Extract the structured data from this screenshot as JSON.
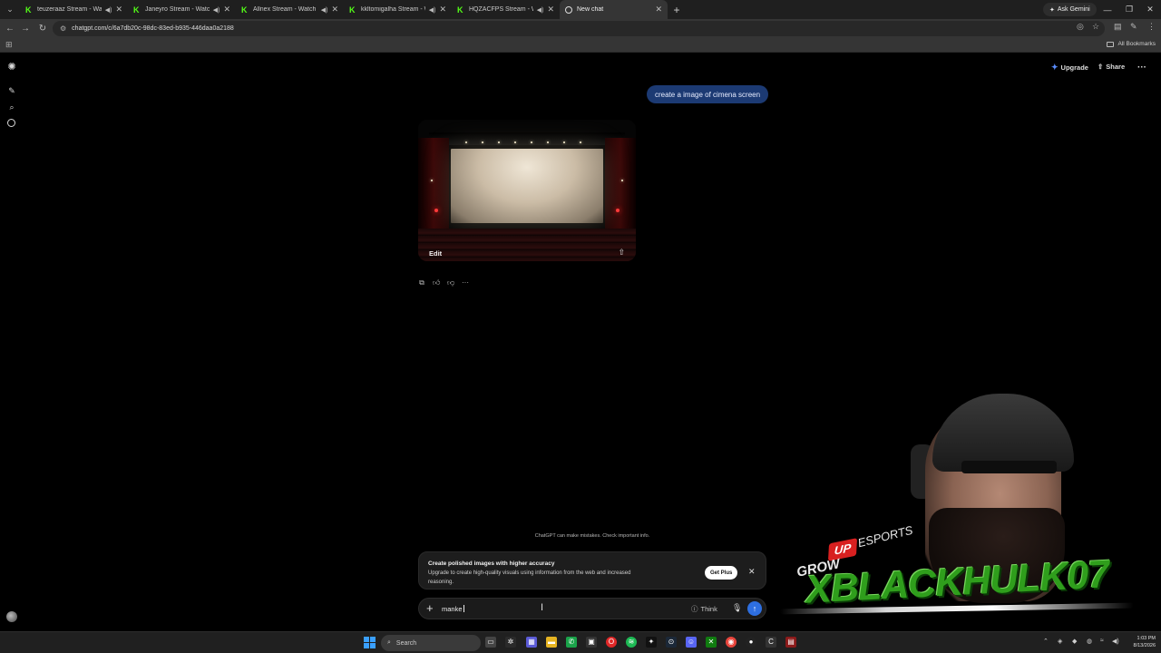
{
  "browser": {
    "tabs": [
      {
        "title": "teuzeraaz Stream - Watch L",
        "favicon": "kick-icon",
        "audio": true
      },
      {
        "title": "Janeyro Stream - Watch Live",
        "favicon": "kick-icon",
        "audio": true
      },
      {
        "title": "Allnex Stream - Watch Live",
        "favicon": "kick-icon",
        "audio": true
      },
      {
        "title": "kkltomigalha Stream - Watch",
        "favicon": "kick-icon",
        "audio": true
      },
      {
        "title": "HQZACFPS Stream - Watch Li",
        "favicon": "kick-icon",
        "audio": true
      },
      {
        "title": "New chat",
        "favicon": "chatgpt-icon",
        "audio": false
      }
    ],
    "ask_gemini_label": "Ask Gemini",
    "url": "chatgpt.com/c/6a7db20c-98dc-83ed-b935-446daa0a2188",
    "all_bookmarks_label": "All Bookmarks"
  },
  "chat": {
    "upgrade_label": "Upgrade",
    "share_label": "Share",
    "user_message": "create a image of cimena screen",
    "image_edit_label": "Edit",
    "disclaimer": "ChatGPT can make mistakes. Check important info.",
    "promo": {
      "title": "Create polished images with higher accuracy",
      "body": "Upgrade to create high-quality visuals using information from the web and increased reasoning.",
      "button": "Get Plus"
    },
    "composer": {
      "text": "manke",
      "think_label": "Think"
    }
  },
  "overlay": {
    "grow": "GROW",
    "up": "UP",
    "esports": "ESPORTS",
    "name": "XBLACKHULK07"
  },
  "taskbar": {
    "search_label": "Search",
    "time": "1:03 PM",
    "date": "8/13/2026"
  },
  "colors": {
    "accent_blue": "#2e6fe0",
    "kick_green": "#53fc18",
    "brand_green": "#2f9e1c"
  }
}
